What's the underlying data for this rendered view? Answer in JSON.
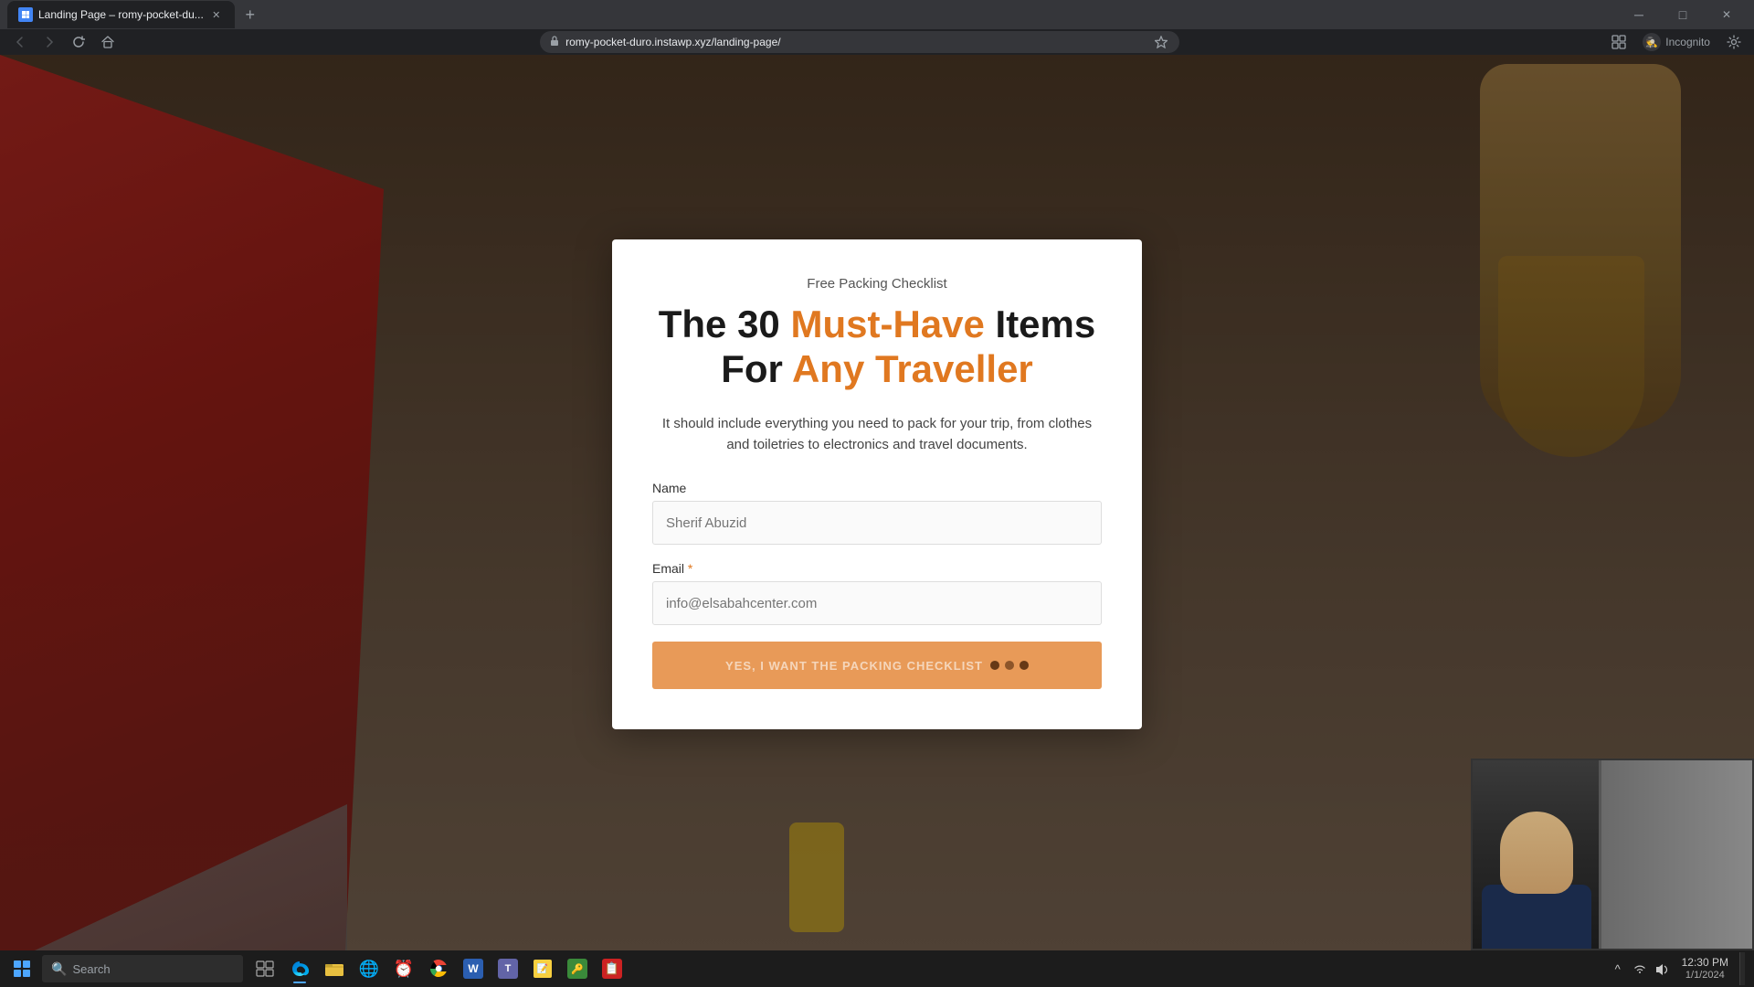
{
  "browser": {
    "tab_title": "Landing Page – romy-pocket-du...",
    "favicon_label": "wordpress-favicon",
    "url": "romy-pocket-duro.instawp.xyz/landing-page/",
    "new_tab_label": "+",
    "back_btn": "←",
    "forward_btn": "→",
    "refresh_btn": "↻",
    "home_btn": "⌂",
    "incognito_label": "Incognito",
    "win_minimize": "─",
    "win_maximize": "□",
    "win_close": "✕",
    "profile_label": "Incognito"
  },
  "modal": {
    "subtitle": "Free Packing Checklist",
    "title_part1": "The 30 ",
    "title_highlight1": "Must-Have",
    "title_part2": " Items",
    "title_part3": "For ",
    "title_highlight2": "Any Traveller",
    "description": "It should include everything you need to pack for your trip, from clothes and\ntoiletries to electronics and travel documents.",
    "name_label": "Name",
    "name_placeholder": "Sherif Abuzid",
    "email_label": "Email",
    "email_required": " *",
    "email_placeholder": "info@elsabahcenter.com",
    "submit_label": "YES, I WANT THE PACKING CHECKLIST",
    "submit_loading": true
  },
  "taskbar": {
    "search_placeholder": "Search",
    "search_icon": "🔍",
    "items": [
      {
        "id": "windows-icon",
        "color": "#4da6ff"
      },
      {
        "id": "cortana-item"
      },
      {
        "id": "taskview-item"
      },
      {
        "id": "edge-item",
        "active": true
      },
      {
        "id": "explorer-item"
      },
      {
        "id": "clock-item"
      },
      {
        "id": "chrome-item"
      },
      {
        "id": "word-item"
      },
      {
        "id": "teams-item"
      },
      {
        "id": "sticky-notes-item"
      },
      {
        "id": "keepass-item"
      },
      {
        "id": "clipboard-item"
      }
    ],
    "clock_time": "12:30 PM",
    "clock_date": "1/1/2024"
  }
}
